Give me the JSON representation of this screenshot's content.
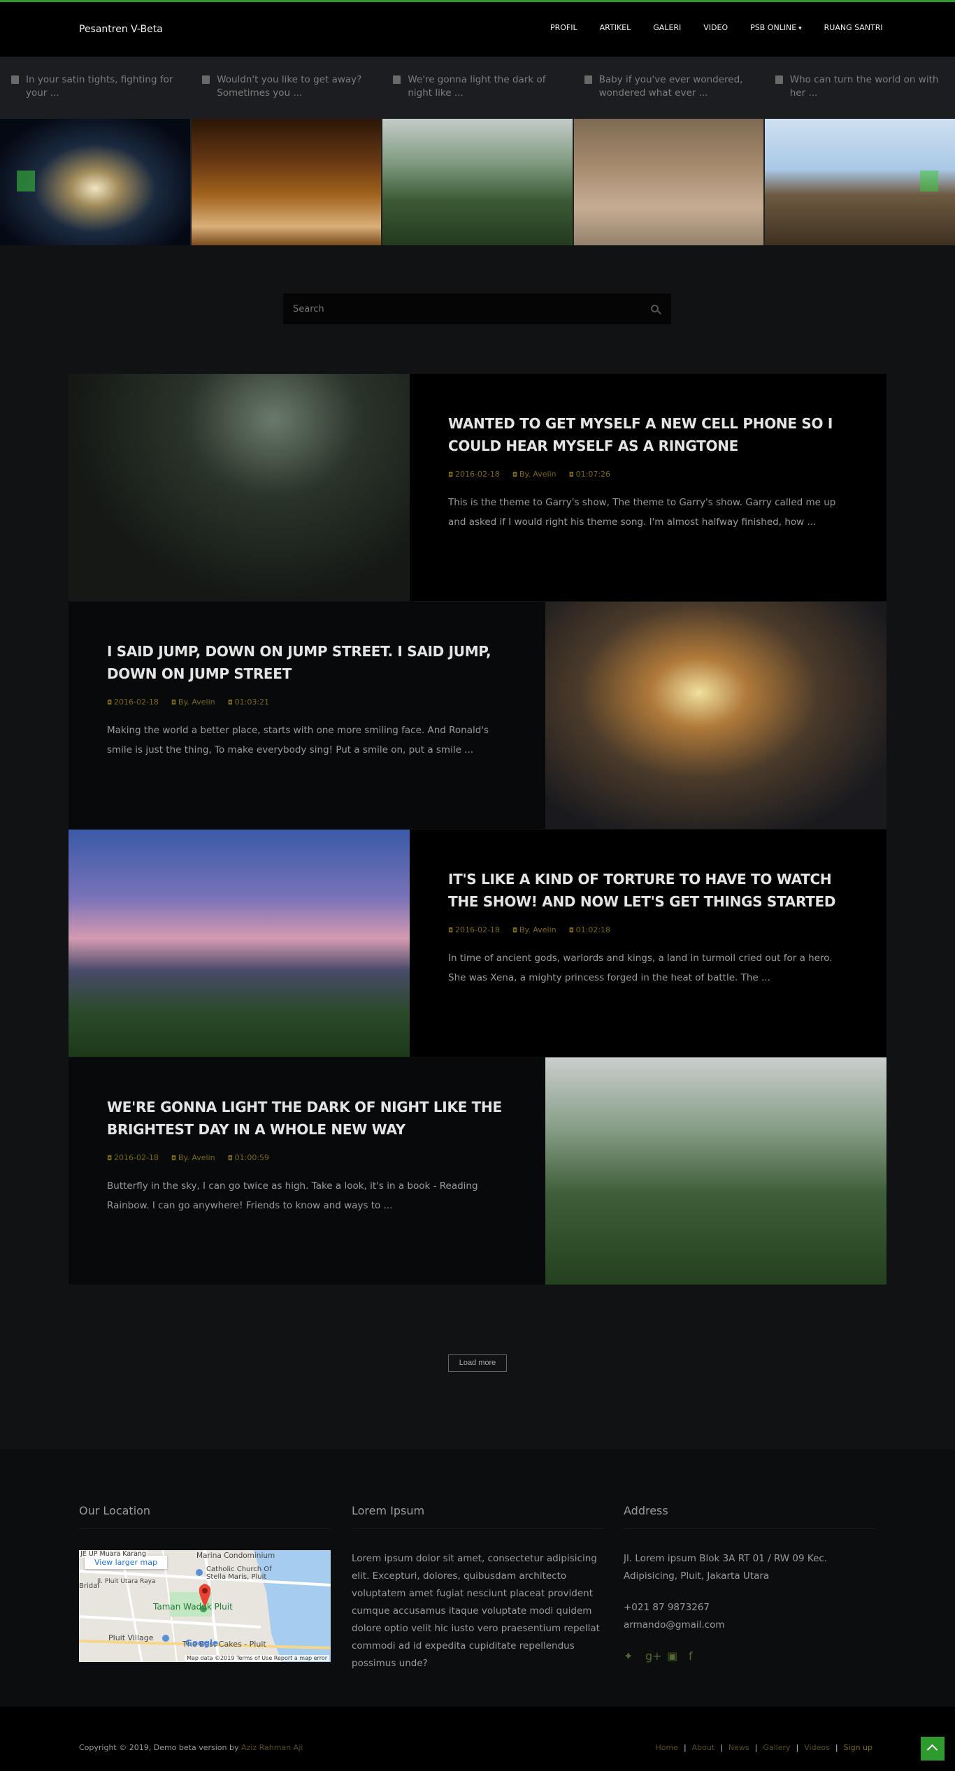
{
  "brand": "Pesantren V-Beta",
  "nav": [
    "PROFIL",
    "ARTIKEL",
    "GALERI",
    "VIDEO",
    "PSB ONLINE",
    "RUANG SANTRI"
  ],
  "ticker": [
    "In your satin tights, fighting for your ...",
    "Wouldn't you like to get away? Sometimes you ...",
    "We're gonna light the dark of night like ...",
    "Baby if you've ever wondered, wondered what ever ...",
    "Who can turn the world on with her ..."
  ],
  "search": {
    "placeholder": "Search"
  },
  "posts": [
    {
      "title": "WANTED TO GET MYSELF A NEW CELL PHONE SO I COULD HEAR MYSELF AS A RINGTONE",
      "date": "2016-02-18",
      "author": "By. Avelin",
      "time": "01:07:26",
      "excerpt": "This is the theme to Garry's show, The theme to Garry's show. Garry called me up and asked if I would right his theme song. I'm almost halfway finished, how ..."
    },
    {
      "title": "I SAID JUMP, DOWN ON JUMP STREET. I SAID JUMP, DOWN ON JUMP STREET",
      "date": "2016-02-18",
      "author": "By. Avelin",
      "time": "01:03:21",
      "excerpt": "Making the world a better place, starts with one more smiling face. And Ronald's smile is just the thing, To make everybody sing! Put a smile on, put a smile ..."
    },
    {
      "title": "IT'S LIKE A KIND OF TORTURE TO HAVE TO WATCH THE SHOW! AND NOW LET'S GET THINGS STARTED",
      "date": "2016-02-18",
      "author": "By. Avelin",
      "time": "01:02:18",
      "excerpt": "In time of ancient gods, warlords and kings, a land in turmoil cried out for a hero. She was Xena, a mighty princess forged in the heat of battle. The ..."
    },
    {
      "title": "WE'RE GONNA LIGHT THE DARK OF NIGHT LIKE THE BRIGHTEST DAY IN A WHOLE NEW WAY",
      "date": "2016-02-18",
      "author": "By. Avelin",
      "time": "01:00:59",
      "excerpt": "Butterfly in the sky, I can go twice as high. Take a look, it's in a book - Reading Rainbow. I can go anywhere! Friends to know and ways to ..."
    }
  ],
  "load_more": "Load more",
  "footer": {
    "location_title": "Our Location",
    "lorem_title": "Lorem Ipsum",
    "lorem_text": "Lorem ipsum dolor sit amet, consectetur adipisicing elit. Excepturi, dolores, quibusdam architecto voluptatem amet fugiat nesciunt placeat provident cumque accusamus itaque voluptate modi quidem dolore optio velit hic iusto vero praesentium repellat commodi ad id expedita cupiditate repellendus possimus unde?",
    "address_title": "Address",
    "address": "Jl. Lorem ipsum Blok 3A RT 01 / RW 09 Kec. Adipisicing, Pluit, Jakarta Utara",
    "phone": "+021 87 9873267",
    "email": "armando@gmail.com",
    "map": {
      "view_larger": "View larger map",
      "labels": [
        "Marina Condominium",
        "Catholic Church Of Stella Maris, Pluit",
        "Jl. Pluit Utara Raya",
        "Bridal",
        "Taman Waduk Pluit",
        "Pluit Village",
        "The Best Cakes - Pluit",
        "JE UP Muara Karang"
      ],
      "footer_text": "Map data ©2019   Terms of Use   Report a map error",
      "google": "Google"
    }
  },
  "copyright": "Copyright © 2019, Demo beta version by",
  "copyright_author": "Aziz Rahman Aji",
  "footer_links": [
    "Home",
    "About",
    "News",
    "Gallery",
    "Videos",
    "Sign up"
  ],
  "colors": {
    "accent": "#2e9b2e",
    "meta": "#7a6718",
    "background": "#111214"
  }
}
